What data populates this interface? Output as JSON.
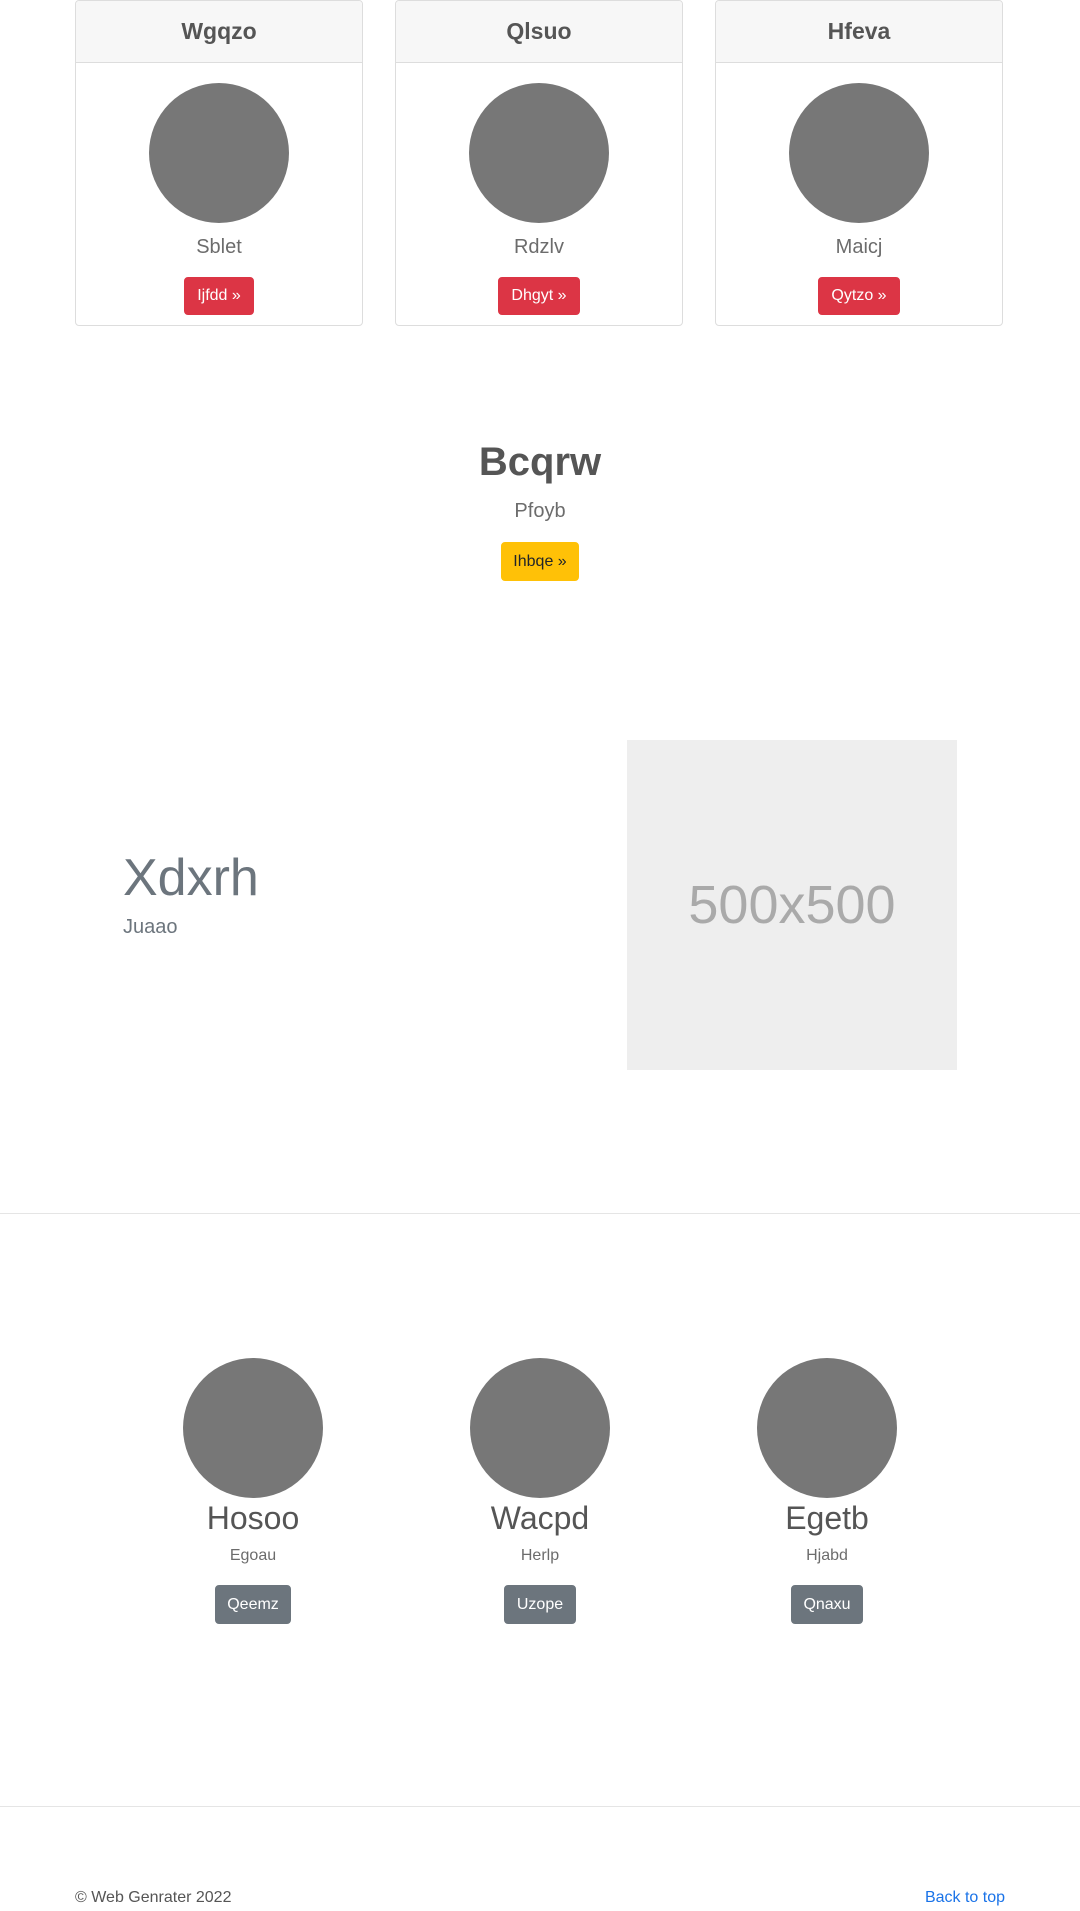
{
  "cards": [
    {
      "title": "Wgqzo",
      "subtitle": "Sblet",
      "button": "Ijfdd »"
    },
    {
      "title": "Qlsuo",
      "subtitle": "Rdzlv",
      "button": "Dhgyt »"
    },
    {
      "title": "Hfeva",
      "subtitle": "Maicj",
      "button": "Qytzo »"
    }
  ],
  "hero": {
    "title": "Bcqrw",
    "subtitle": "Pfoyb",
    "button": "Ihbqe »"
  },
  "feature": {
    "title": "Xdxrh",
    "subtitle": "Juaao",
    "image_label": "500x500"
  },
  "trio": [
    {
      "name": "Hosoo",
      "subtitle": "Egoau",
      "button": "Qeemz"
    },
    {
      "name": "Wacpd",
      "subtitle": "Herlp",
      "button": "Uzope"
    },
    {
      "name": "Egetb",
      "subtitle": "Hjabd",
      "button": "Qnaxu"
    }
  ],
  "footer": {
    "copyright": "© Web Genrater 2022",
    "back_to_top": "Back to top"
  },
  "colors": {
    "danger": "#dc3545",
    "warning": "#ffc107",
    "secondary": "#6c757d",
    "link": "#1a73e8"
  }
}
